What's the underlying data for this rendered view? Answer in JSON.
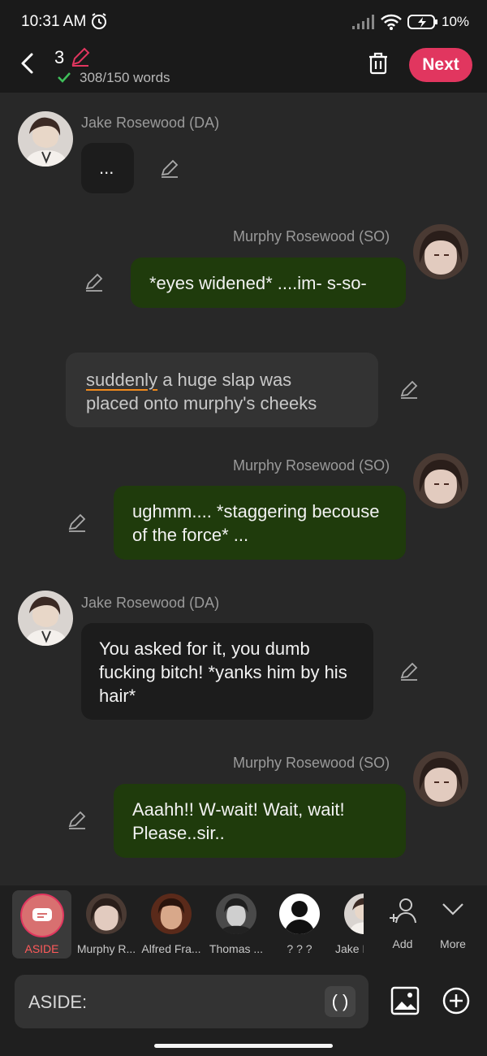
{
  "status_bar": {
    "time": "10:31 AM",
    "battery": "10%"
  },
  "header": {
    "count": "3",
    "word_count": "308/150 words",
    "next_label": "Next"
  },
  "messages": [
    {
      "speaker": "Jake Rosewood (DA)",
      "text": "..."
    },
    {
      "speaker": "Murphy Rosewood (SO)",
      "text": "*eyes widened* ....im- s-so-"
    },
    {
      "narration_first": "suddenly",
      "narration_rest_1": " a huge slap was",
      "narration_rest_2": "placed onto murphy's cheeks"
    },
    {
      "speaker": "Murphy Rosewood (SO)",
      "text": "ughmm.... *staggering becouse of the force* ..."
    },
    {
      "speaker": "Jake Rosewood (DA)",
      "text": "You asked for it, you dumb fucking bitch! *yanks him by his hair*"
    },
    {
      "speaker": "Murphy Rosewood (SO)",
      "text": "Aaahh!! W-wait! Wait, wait! Please..sir.."
    }
  ],
  "characters": [
    {
      "label": "ASIDE",
      "selected": true
    },
    {
      "label": "Murphy R..."
    },
    {
      "label": "Alfred Fra..."
    },
    {
      "label": "Thomas ..."
    },
    {
      "label": "? ? ?"
    },
    {
      "label": "Jake R"
    }
  ],
  "actions": {
    "add": "Add",
    "more": "More"
  },
  "composer": {
    "prefix": "ASIDE:",
    "paren": "( )"
  },
  "colors": {
    "accent": "#e1365f",
    "green_bubble": "#1f3b0c",
    "check": "#3fbf5a",
    "underline": "#f08a1c"
  }
}
